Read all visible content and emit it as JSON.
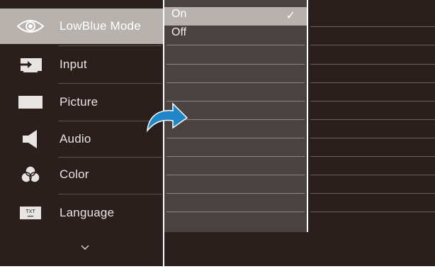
{
  "menu": {
    "items": [
      {
        "label": "LowBlue Mode",
        "icon": "eye-icon"
      },
      {
        "label": "Input",
        "icon": "input-icon"
      },
      {
        "label": "Picture",
        "icon": "picture-icon"
      },
      {
        "label": "Audio",
        "icon": "speaker-icon"
      },
      {
        "label": "Color",
        "icon": "color-icon"
      },
      {
        "label": "Language",
        "icon": "language-icon"
      }
    ],
    "more_icon": "chevron-down-icon"
  },
  "submenu": {
    "options": [
      {
        "label": "On",
        "selected": true
      },
      {
        "label": "Off",
        "selected": false
      }
    ],
    "check_mark": "✓"
  },
  "colors": {
    "panel_dark": "#2a1f1d",
    "panel_mid": "#4a4240",
    "highlight": "#b7b2ae",
    "arrow_blue": "#1f86c7"
  }
}
